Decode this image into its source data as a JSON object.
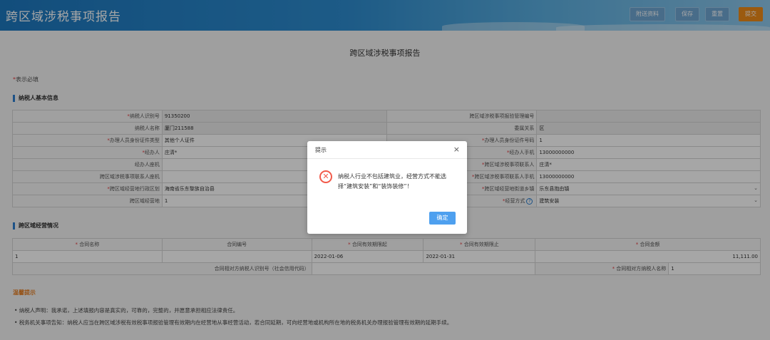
{
  "header": {
    "title": "跨区域涉税事项报告",
    "buttons": [
      "附送资料",
      "保存",
      "重置",
      "提交"
    ]
  },
  "page": {
    "title": "跨区域涉税事项报告",
    "required_note": "表示必填",
    "required_star": "*"
  },
  "taxpayer_section": {
    "title": "纳税人基本信息",
    "rows": [
      [
        {
          "label": "纳税人识别号",
          "req": true,
          "value": "91350200",
          "ro": true
        },
        {
          "label": "跨区域涉税事项报验管理编号",
          "req": false,
          "value": "",
          "ro": true
        }
      ],
      [
        {
          "label": "纳税人名称",
          "req": false,
          "value": "厦门211588",
          "ro": true
        },
        {
          "label": "委属关系",
          "req": false,
          "value": "区",
          "ro": true
        }
      ],
      [
        {
          "label": "办理人员身份证件类型",
          "req": true,
          "value": "其他个人证件",
          "ro": false
        },
        {
          "label": "办理人员身份证件号码",
          "req": true,
          "value": "1",
          "ro": false
        }
      ],
      [
        {
          "label": "经办人",
          "req": true,
          "value": "庄清*",
          "ro": false
        },
        {
          "label": "经办人手机",
          "req": true,
          "value": "13000000000",
          "ro": false
        }
      ],
      [
        {
          "label": "经办人座机",
          "req": false,
          "value": "",
          "ro": false
        },
        {
          "label": "跨区域涉税事项联系人",
          "req": true,
          "value": "庄清*",
          "ro": false
        }
      ],
      [
        {
          "label": "跨区域涉税事项联系人座机",
          "req": false,
          "value": "",
          "ro": false
        },
        {
          "label": "跨区域涉税事项联系人手机",
          "req": true,
          "value": "13000000000",
          "ro": false
        }
      ],
      [
        {
          "label": "跨区域经营地行政区划",
          "req": true,
          "value": "海南省乐东黎族自治县",
          "ro": false
        },
        {
          "label": "跨区域经营地街道乡镇",
          "req": true,
          "value": "乐东县抱由镇",
          "ro": false,
          "select": true
        }
      ],
      [
        {
          "label": "跨区域经营地",
          "req": false,
          "value": "1",
          "ro": false
        },
        {
          "label": "经营方式",
          "req": true,
          "value": "建筑安装",
          "ro": false,
          "select": true,
          "help": true
        }
      ]
    ]
  },
  "business_section": {
    "title": "跨区域经营情况",
    "headers": [
      {
        "label": "合同名称",
        "req": true
      },
      {
        "label": "合同编号",
        "req": false
      },
      {
        "label": "合同有效期限起",
        "req": true
      },
      {
        "label": "合同有效期限止",
        "req": true
      },
      {
        "label": "合同金额",
        "req": true
      }
    ],
    "row": [
      "1",
      "",
      "2022-01-06",
      "2022-01-31",
      "11,111.00"
    ],
    "counterparty": {
      "id_label": "合同相对方纳税人识别号（社会信用代码）",
      "id_value": "",
      "name_label": "合同相对方纳税人名称",
      "name_req": true,
      "name_value": "1"
    }
  },
  "tips": {
    "title": "温馨提示",
    "items": [
      "纳税人声明：我承诺，上述填报内容是真实的，可靠的，完整的，并愿意承担相应法律责任。",
      "税务机关事项告知：纳税人应当在跨区域涉税有效税事项报验管理有效期内在经营地从事经营活动，若合同延期，可向经营地或机构所在地的税务机关办理报验管理有效期的延期手续。"
    ]
  },
  "dialog": {
    "title": "提示",
    "close_glyph": "×",
    "icon_glyph": "✕",
    "message": "纳税人行业不包括建筑业，经营方式不能选择“建筑安装”和“装饰装修”！",
    "ok_label": "确定"
  },
  "colors": {
    "header_blue": "#1d78bf",
    "submit_orange": "#ef8a18",
    "required_red": "#e4393c",
    "dialog_error": "#f25a4a",
    "confirm_blue": "#4ea0ef"
  }
}
